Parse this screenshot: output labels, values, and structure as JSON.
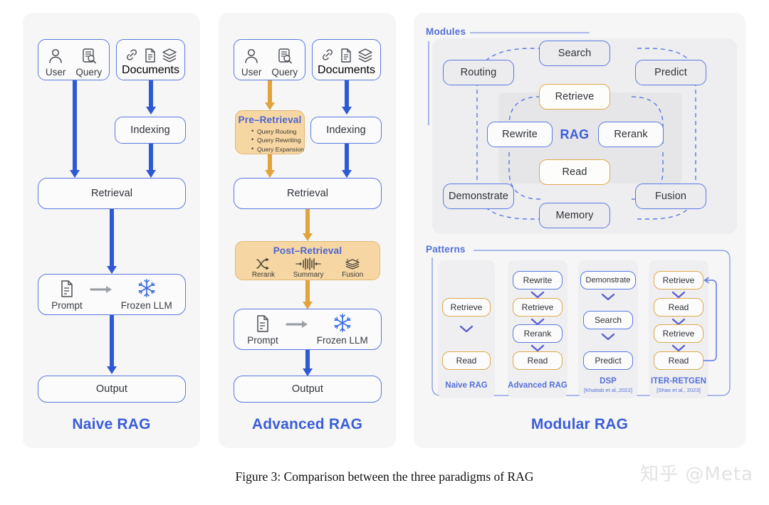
{
  "figure": {
    "caption": "Figure 3: Comparison between the three paradigms of RAG",
    "watermark": "知乎 @Meta"
  },
  "colors": {
    "title_blue": "#3b5ed7",
    "node_border_blue": "#5b78e0",
    "node_border_orange": "#dda94a",
    "arrow_blue": "#2f58d3",
    "arrow_orange": "#e2a23c",
    "stage_orange_fill": "#f6d6a2",
    "panel_bg": "#f6f6f7"
  },
  "naive": {
    "title": "Naive RAG",
    "input_left": [
      {
        "icon": "user-icon",
        "label": "User"
      },
      {
        "icon": "query-document-search-icon",
        "label": "Query"
      }
    ],
    "input_right": {
      "icons": [
        "link-icon",
        "document-icon",
        "layers-icon"
      ],
      "label": "Documents"
    },
    "indexing": "Indexing",
    "retrieval": "Retrieval",
    "generation": {
      "prompt_icon": "document-icon",
      "prompt_label": "Prompt",
      "arrow_icon": "right-arrow-icon",
      "llm_icon": "snowflake-icon",
      "llm_label": "Frozen LLM"
    },
    "output": "Output"
  },
  "advanced": {
    "title": "Advanced RAG",
    "input_left": [
      {
        "icon": "user-icon",
        "label": "User"
      },
      {
        "icon": "query-document-search-icon",
        "label": "Query"
      }
    ],
    "input_right": {
      "icons": [
        "link-icon",
        "document-icon",
        "layers-icon"
      ],
      "label": "Documents"
    },
    "pre_retrieval": {
      "title": "Pre–Retrieval",
      "items": [
        "Query Routing",
        "Query Rewriting",
        "Query Expansion"
      ]
    },
    "indexing": "Indexing",
    "retrieval": "Retrieval",
    "post_retrieval": {
      "title": "Post–Retrieval",
      "items": [
        {
          "icon": "crossing-arrows-icon",
          "label": "Rerank"
        },
        {
          "icon": "waveform-icon",
          "label": "Summary"
        },
        {
          "icon": "stacked-layers-icon",
          "label": "Fusion"
        }
      ]
    },
    "generation": {
      "prompt_icon": "document-icon",
      "prompt_label": "Prompt",
      "arrow_icon": "right-arrow-icon",
      "llm_icon": "snowflake-icon",
      "llm_label": "Frozen LLM"
    },
    "output": "Output"
  },
  "modular": {
    "title": "Modular RAG",
    "modules_label": "Modules",
    "patterns_label": "Patterns",
    "center_label": "RAG",
    "modules": {
      "outer": [
        "Search",
        "Routing",
        "Predict",
        "Demonstrate",
        "Fusion",
        "Memory"
      ],
      "inner": [
        "Retrieve",
        "Rewrite",
        "Rerank",
        "Read"
      ]
    },
    "patterns": [
      {
        "name": "Naive RAG",
        "cite": "",
        "steps": [
          {
            "label": "Retrieve",
            "style": "orange"
          },
          {
            "label": "Read",
            "style": "orange"
          }
        ]
      },
      {
        "name": "Advanced RAG",
        "cite": "",
        "steps": [
          {
            "label": "Rewrite",
            "style": "blue"
          },
          {
            "label": "Retrieve",
            "style": "orange"
          },
          {
            "label": "Rerank",
            "style": "blue"
          },
          {
            "label": "Read",
            "style": "orange"
          }
        ]
      },
      {
        "name": "DSP",
        "cite": "[Khattab et al.,2022]",
        "steps": [
          {
            "label": "Demonstrate",
            "style": "blue"
          },
          {
            "label": "Search",
            "style": "blue"
          },
          {
            "label": "Predict",
            "style": "blue"
          }
        ]
      },
      {
        "name": "ITER-RETGEN",
        "cite": "[Shao et al., 2023]",
        "steps": [
          {
            "label": "Retrieve",
            "style": "orange"
          },
          {
            "label": "Read",
            "style": "orange"
          },
          {
            "label": "Retrieve",
            "style": "orange"
          },
          {
            "label": "Read",
            "style": "orange"
          }
        ]
      }
    ]
  }
}
